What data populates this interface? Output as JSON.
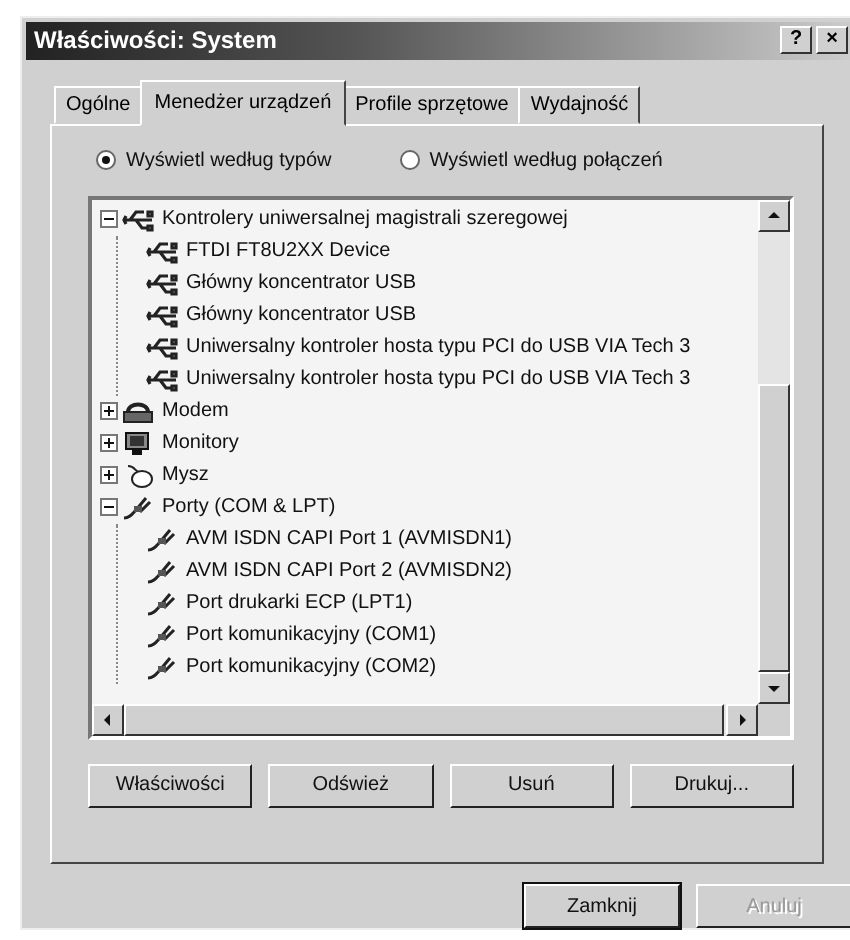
{
  "window": {
    "title": "Właściwości: System",
    "help": "?",
    "close": "×"
  },
  "tabs": [
    {
      "label": "Ogólne",
      "selected": false
    },
    {
      "label": "Menedżer urządzeń",
      "selected": true
    },
    {
      "label": "Profile sprzętowe",
      "selected": false
    },
    {
      "label": "Wydajność",
      "selected": false
    }
  ],
  "view_options": [
    {
      "label": "Wyświetl według typów",
      "selected": true
    },
    {
      "label": "Wyświetl według połączeń",
      "selected": false
    }
  ],
  "tree": [
    {
      "label": "Kontrolery uniwersalnej magistrali szeregowej",
      "kind": "usb",
      "expanded": true,
      "children": [
        {
          "label": "FTDI FT8U2XX Device",
          "kind": "usb"
        },
        {
          "label": "Główny koncentrator USB",
          "kind": "usb"
        },
        {
          "label": "Główny koncentrator USB",
          "kind": "usb"
        },
        {
          "label": "Uniwersalny kontroler hosta typu PCI do USB VIA Tech 3",
          "kind": "usb"
        },
        {
          "label": "Uniwersalny kontroler hosta typu PCI do USB VIA Tech 3",
          "kind": "usb"
        }
      ]
    },
    {
      "label": "Modem",
      "kind": "modem",
      "expanded": false
    },
    {
      "label": "Monitory",
      "kind": "monitor",
      "expanded": false
    },
    {
      "label": "Mysz",
      "kind": "mouse",
      "expanded": false
    },
    {
      "label": "Porty (COM & LPT)",
      "kind": "port",
      "expanded": true,
      "children": [
        {
          "label": "AVM ISDN CAPI Port 1 (AVMISDN1)",
          "kind": "port"
        },
        {
          "label": "AVM ISDN CAPI Port 2 (AVMISDN2)",
          "kind": "port"
        },
        {
          "label": "Port drukarki ECP (LPT1)",
          "kind": "port"
        },
        {
          "label": "Port komunikacyjny (COM1)",
          "kind": "port"
        },
        {
          "label": "Port komunikacyjny (COM2)",
          "kind": "port"
        }
      ]
    }
  ],
  "buttons": [
    "Właściwości",
    "Odśwież",
    "Usuń",
    "Drukuj..."
  ],
  "dialog_buttons": [
    {
      "label": "Zamknij",
      "disabled": false
    },
    {
      "label": "Anuluj",
      "disabled": true
    }
  ]
}
